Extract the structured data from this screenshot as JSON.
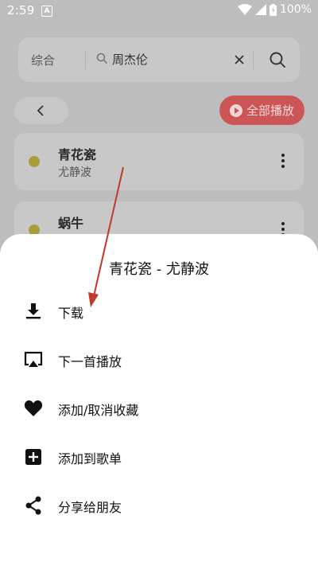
{
  "status_bar": {
    "time": "2:59",
    "notification_letter": "A",
    "battery": "100%"
  },
  "search": {
    "type_label": "综合",
    "query": "周杰伦"
  },
  "toolbar": {
    "play_all_label": "全部播放"
  },
  "songs": [
    {
      "title": "青花瓷",
      "artist": "尤静波"
    },
    {
      "title": "蜗牛",
      "artist": ""
    }
  ],
  "sheet": {
    "title": "青花瓷 - 尤静波",
    "items": [
      {
        "label": "下载",
        "icon": "download-icon"
      },
      {
        "label": "下一首播放",
        "icon": "airplay-icon"
      },
      {
        "label": "添加/取消收藏",
        "icon": "heart-icon"
      },
      {
        "label": "添加到歌单",
        "icon": "add-box-icon"
      },
      {
        "label": "分享给朋友",
        "icon": "share-icon"
      }
    ]
  },
  "colors": {
    "accent": "#cc5555",
    "scrim": "#bdbdbd",
    "song_dot": "#a99c3a",
    "arrow": "#c0392b"
  }
}
